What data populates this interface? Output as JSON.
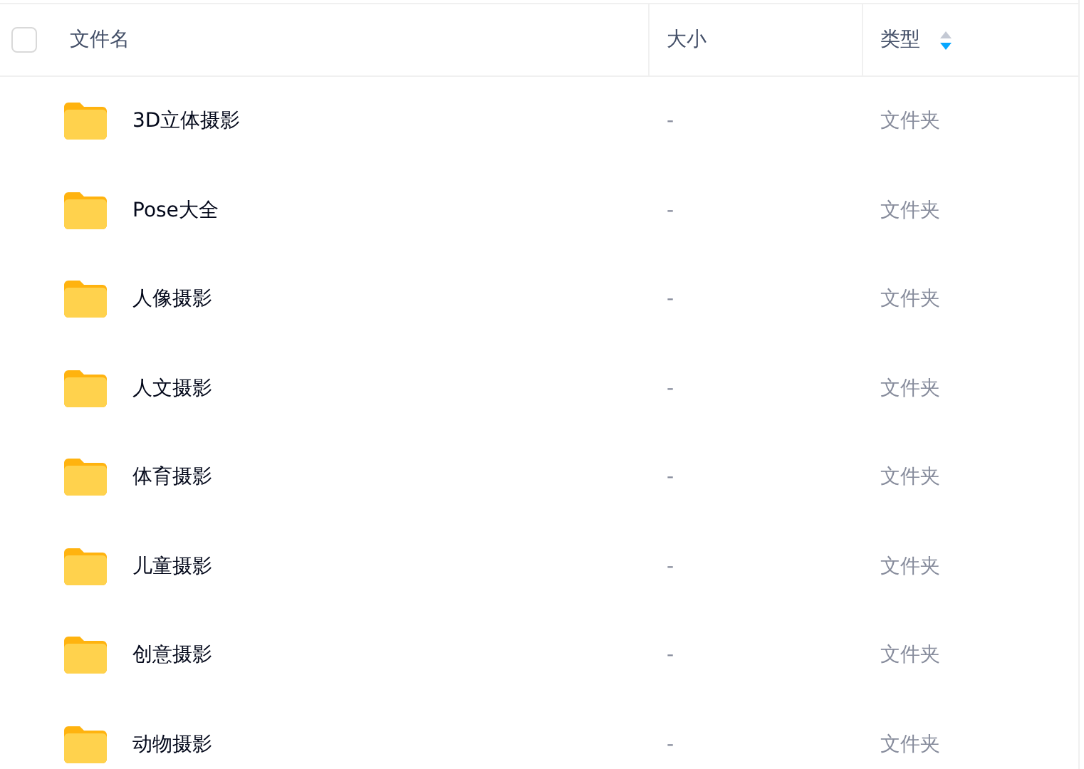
{
  "header": {
    "select_all": {
      "checked": false
    },
    "columns": [
      {
        "label": "文件名",
        "sorted": false
      },
      {
        "label": "大小",
        "sorted": false
      },
      {
        "label": "类型",
        "sorted": true
      }
    ]
  },
  "rows": [
    {
      "name": "3D立体摄影",
      "size": "-",
      "type": "文件夹"
    },
    {
      "name": "Pose大全",
      "size": "-",
      "type": "文件夹"
    },
    {
      "name": "人像摄影",
      "size": "-",
      "type": "文件夹"
    },
    {
      "name": "人文摄影",
      "size": "-",
      "type": "文件夹"
    },
    {
      "name": "体育摄影",
      "size": "-",
      "type": "文件夹"
    },
    {
      "name": "儿童摄影",
      "size": "-",
      "type": "文件夹"
    },
    {
      "name": "创意摄影",
      "size": "-",
      "type": "文件夹"
    },
    {
      "name": "动物摄影",
      "size": "-",
      "type": "文件夹"
    }
  ]
}
